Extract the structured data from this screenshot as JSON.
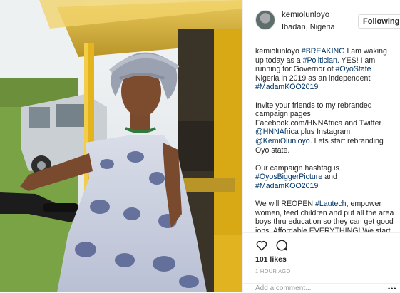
{
  "post": {
    "username": "kemiolunloyo",
    "location": "Ibadan, Nigeria",
    "follow_label": "Following",
    "caption": {
      "user": "kemiolunloyo",
      "p1_tag1": "#BREAKING",
      "p1_text1": " I am waking up today as a ",
      "p1_tag2": "#Politician",
      "p1_text2": ". YES! I am running for Governor of ",
      "p1_tag3": "#OyoState",
      "p1_text3": " Nigeria in 2019 as an independent ",
      "p1_tag4": "#MadamKOO2019",
      "p2_text1": "Invite your friends to my rebranded campaign pages Facebook.com/HNNAfrica and Twitter ",
      "p2_tag1": "@HNNAfrica",
      "p2_text2": " plus Instagram ",
      "p2_tag2": "@KemiOlunloyo",
      "p2_text3": ". Lets start rebranding Oyo state.",
      "p3_text1": "Our campaign hashtag is ",
      "p3_tag1": "#OyosBiggerPicture",
      "p3_text2": " and ",
      "p3_tag2": "#MadamKOO2019",
      "p4_text1": "We will REOPEN ",
      "p4_tag1": "#Lautech",
      "p4_text2": ", empower women, feed children and put all the area boys thru education so they can get good jobs. Affordable EVERYTHING! We start on the streets!! Our Campaign donation portal is coming and phone number is posted. I am running a social media and grassroots"
    },
    "likes": "101 likes",
    "time": "1 HOUR AGO",
    "comment_placeholder": "Add a comment...",
    "more_icon": "more-dots-icon"
  },
  "icons": {
    "like": "heart-icon",
    "comment": "comment-bubble-icon"
  },
  "colors": {
    "tag": "#003569",
    "text": "#262626",
    "muted": "#999999",
    "photo_frame": "#e8b81e"
  }
}
